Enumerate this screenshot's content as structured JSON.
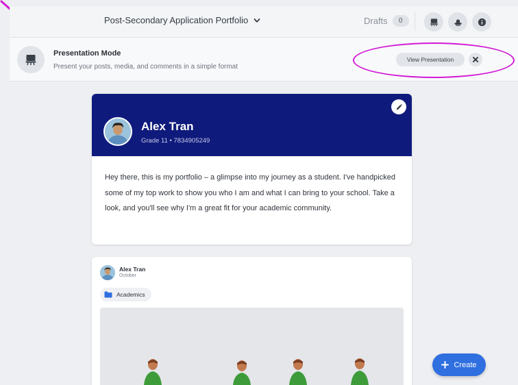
{
  "topbar": {
    "portfolio_title": "Post-Secondary Application Portfolio",
    "drafts_label": "Drafts",
    "drafts_count": "0",
    "actions": [
      {
        "icon": "presentation-icon"
      },
      {
        "icon": "visitor-hat-icon"
      },
      {
        "icon": "info-icon"
      }
    ]
  },
  "presentation_banner": {
    "icon": "presentation-icon",
    "title": "Presentation Mode",
    "subtitle": "Present your posts, media, and comments in a simple format",
    "view_button": "View Presentation",
    "close_icon": "close-icon"
  },
  "profile": {
    "name": "Alex Tran",
    "meta": "Grade 11 • 7834905249",
    "bio": "Hey there, this is my portfolio – a glimpse into my journey as a student. I've handpicked some of my top work to show you who I am and what I can bring to your school. Take a look, and you'll see why I'm a great fit for your academic community.",
    "edit_icon": "pencil-icon"
  },
  "post": {
    "author": "Alex Tran",
    "date": "October",
    "tag": "Academics",
    "tag_icon": "folder-icon"
  },
  "create_button": {
    "label": "Create",
    "icon": "plus-icon"
  },
  "colors": {
    "header_navy": "#0f1b7c",
    "accent_blue": "#2f6fe0",
    "annotation_magenta": "#d21ad6"
  }
}
